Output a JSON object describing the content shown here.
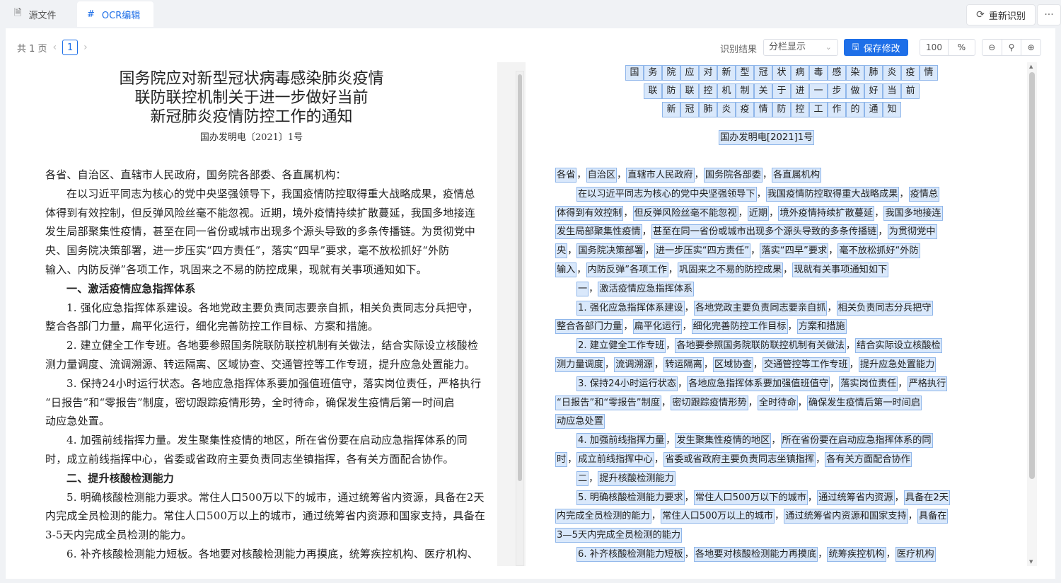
{
  "tabs": [
    {
      "label": "源文件",
      "icon": "file-icon"
    },
    {
      "label": "OCR编辑",
      "icon": "hash-icon"
    }
  ],
  "actions": {
    "reocr": "重新识别",
    "more": "···"
  },
  "toolbar": {
    "page_count": "共 1 页",
    "current_page": "1",
    "result_label": "识别结果",
    "display_mode": "分栏显示",
    "save": "保存修改",
    "zoom": "100",
    "zoom_unit": "%"
  },
  "source": {
    "title_lines": [
      "国务院应对新型冠状病毒感染肺炎疫情",
      "联防联控机制关于进一步做好当前",
      "新冠肺炎疫情防控工作的通知"
    ],
    "doc_number": "国办发明电〔2021〕1号",
    "lines": [
      {
        "text": "各省、自治区、直辖市人民政府，国务院各部委、各直属机构：",
        "indent": false,
        "bold": false
      },
      {
        "text": "在以习近平同志为核心的党中央坚强领导下，我国疫情防控取得重大战略成果，疫情总",
        "indent": true,
        "bold": false
      },
      {
        "text": "体得到有效控制，但反弹风险丝毫不能忽视。近期，境外疫情持续扩散蔓延，我国多地接连",
        "indent": false,
        "bold": false
      },
      {
        "text": "发生局部聚集性疫情，甚至在同一省份或城市出现多个源头导致的多条传播链。为贯彻党中",
        "indent": false,
        "bold": false
      },
      {
        "text": "央、国务院决策部署，进一步压实“四方责任”，落实“四早”要求，毫不放松抓好“外防",
        "indent": false,
        "bold": false
      },
      {
        "text": "输入、内防反弹”各项工作，巩固来之不易的防控成果，现就有关事项通知如下。",
        "indent": false,
        "bold": false
      },
      {
        "text": "一、激活疫情应急指挥体系",
        "indent": true,
        "bold": true
      },
      {
        "text": "1. 强化应急指挥体系建设。各地党政主要负责同志要亲自抓，相关负责同志分兵把守，",
        "indent": true,
        "bold": false
      },
      {
        "text": "整合各部门力量，扁平化运行，细化完善防控工作目标、方案和措施。",
        "indent": false,
        "bold": false
      },
      {
        "text": "2. 建立健全工作专班。各地要参照国务院联防联控机制有关做法，结合实际设立核酸检",
        "indent": true,
        "bold": false
      },
      {
        "text": "测力量调度、流调溯源、转运隔离、区域协查、交通管控等工作专班，提升应急处置能力。",
        "indent": false,
        "bold": false
      },
      {
        "text": "3. 保持24小时运行状态。各地应急指挥体系要加强值班值守，落实岗位责任，严格执行",
        "indent": true,
        "bold": false
      },
      {
        "text": "“日报告”和“零报告”制度，密切跟踪疫情形势，全时待命，确保发生疫情后第一时间启",
        "indent": false,
        "bold": false
      },
      {
        "text": "动应急处置。",
        "indent": false,
        "bold": false
      },
      {
        "text": "4. 加强前线指挥力量。发生聚集性疫情的地区，所在省份要在启动应急指挥体系的同",
        "indent": true,
        "bold": false
      },
      {
        "text": "时，成立前线指挥中心，省委或省政府主要负责同志坐镇指挥，各有关方面配合协作。",
        "indent": false,
        "bold": false
      },
      {
        "text": "二、提升核酸检测能力",
        "indent": true,
        "bold": true
      },
      {
        "text": "5. 明确核酸检测能力要求。常住人口500万以下的城市，通过统筹省内资源，具备在2天",
        "indent": true,
        "bold": false
      },
      {
        "text": "内完成全员检测的能力。常住人口500万以上的城市，通过统筹省内资源和国家支持，具备在",
        "indent": false,
        "bold": false
      },
      {
        "text": "3-5天内完成全员检测的能力。",
        "indent": false,
        "bold": false
      },
      {
        "text": "6. 补齐核酸检测能力短板。各地要对核酸检测能力再摸底，统筹疾控机构、医疗机构、",
        "indent": true,
        "bold": false
      }
    ]
  },
  "ocr": {
    "title_rows": [
      "国务院应对新型冠状病毒感染肺炎疫情",
      "联防联控机制关于进一步做好当前",
      "新冠肺炎疫情防控工作的通知"
    ],
    "doc_number": "国办发明电[2021]1号",
    "lines": [
      {
        "segs": [
          "各省",
          "自治区",
          "直辖市人民政府",
          "国务院各部委",
          "各直属机构"
        ],
        "indent": false
      },
      {
        "segs": [
          "在以习近平同志为核心的党中央坚强领导下",
          "我国疫情防控取得重大战略成果",
          "疫情总"
        ],
        "indent": true
      },
      {
        "segs": [
          "体得到有效控制",
          "但反弹风险丝毫不能忽视",
          "近期",
          "境外疫情持续扩散蔓延",
          "我国多地接连"
        ],
        "indent": false
      },
      {
        "segs": [
          "发生局部聚集性疫情",
          "甚至在同一省份或城市出现多个源头导致的多条传播链",
          "为贯彻党中"
        ],
        "indent": false
      },
      {
        "segs": [
          "央",
          "国务院决策部署",
          "进一步压实“四方责任”",
          "落实“四早”要求",
          "毫不放松抓好“外防"
        ],
        "indent": false
      },
      {
        "segs": [
          "输入",
          "内防反弹”各项工作",
          "巩固来之不易的防控成果",
          "现就有关事项通知如下"
        ],
        "indent": false
      },
      {
        "segs": [
          "一",
          "激活疫情应急指挥体系"
        ],
        "indent": true
      },
      {
        "segs": [
          "1. 强化应急指挥体系建设",
          "各地党政主要负责同志要亲自抓",
          "相关负责同志分兵把守"
        ],
        "indent": true
      },
      {
        "segs": [
          "整合各部门力量",
          "扁平化运行",
          "细化完善防控工作目标",
          "方案和措施"
        ],
        "indent": false
      },
      {
        "segs": [
          "2. 建立健全工作专班",
          "各地要参照国务院联防联控机制有关做法",
          "结合实际设立核酸检"
        ],
        "indent": true
      },
      {
        "segs": [
          "测力量调度",
          "流调溯源",
          "转运隔离",
          "区域协查",
          "交通管控等工作专班",
          "提升应急处置能力"
        ],
        "indent": false
      },
      {
        "segs": [
          "3. 保持24小时运行状态",
          "各地应急指挥体系要加强值班值守",
          "落实岗位责任",
          "严格执行"
        ],
        "indent": true
      },
      {
        "segs": [
          "“日报告”和“零报告”制度",
          "密切跟踪疫情形势",
          "全时待命",
          "确保发生疫情后第一时间启"
        ],
        "indent": false
      },
      {
        "segs": [
          "动应急处置"
        ],
        "indent": false
      },
      {
        "segs": [
          "4. 加强前线指挥力量",
          "发生聚集性疫情的地区",
          "所在省份要在启动应急指挥体系的同"
        ],
        "indent": true
      },
      {
        "segs": [
          "时",
          "成立前线指挥中心",
          "省委或省政府主要负责同志坐镇指挥",
          "各有关方面配合协作"
        ],
        "indent": false
      },
      {
        "segs": [
          "二",
          "提升核酸检测能力"
        ],
        "indent": true
      },
      {
        "segs": [
          "5. 明确核酸检测能力要求",
          "常住人口500万以下的城市",
          "通过统筹省内资源",
          "具备在2天"
        ],
        "indent": true
      },
      {
        "segs": [
          "内完成全员检测的能力",
          "常住人口500万以上的城市",
          "通过统筹省内资源和国家支持",
          "具备在"
        ],
        "indent": false
      },
      {
        "segs": [
          "3—5天内完成全员检测的能力"
        ],
        "indent": false
      },
      {
        "segs": [
          "6. 补齐核酸检测能力短板",
          "各地要对核酸检测能力再摸底",
          "统筹疾控机构",
          "医疗机构"
        ],
        "indent": true
      }
    ]
  }
}
